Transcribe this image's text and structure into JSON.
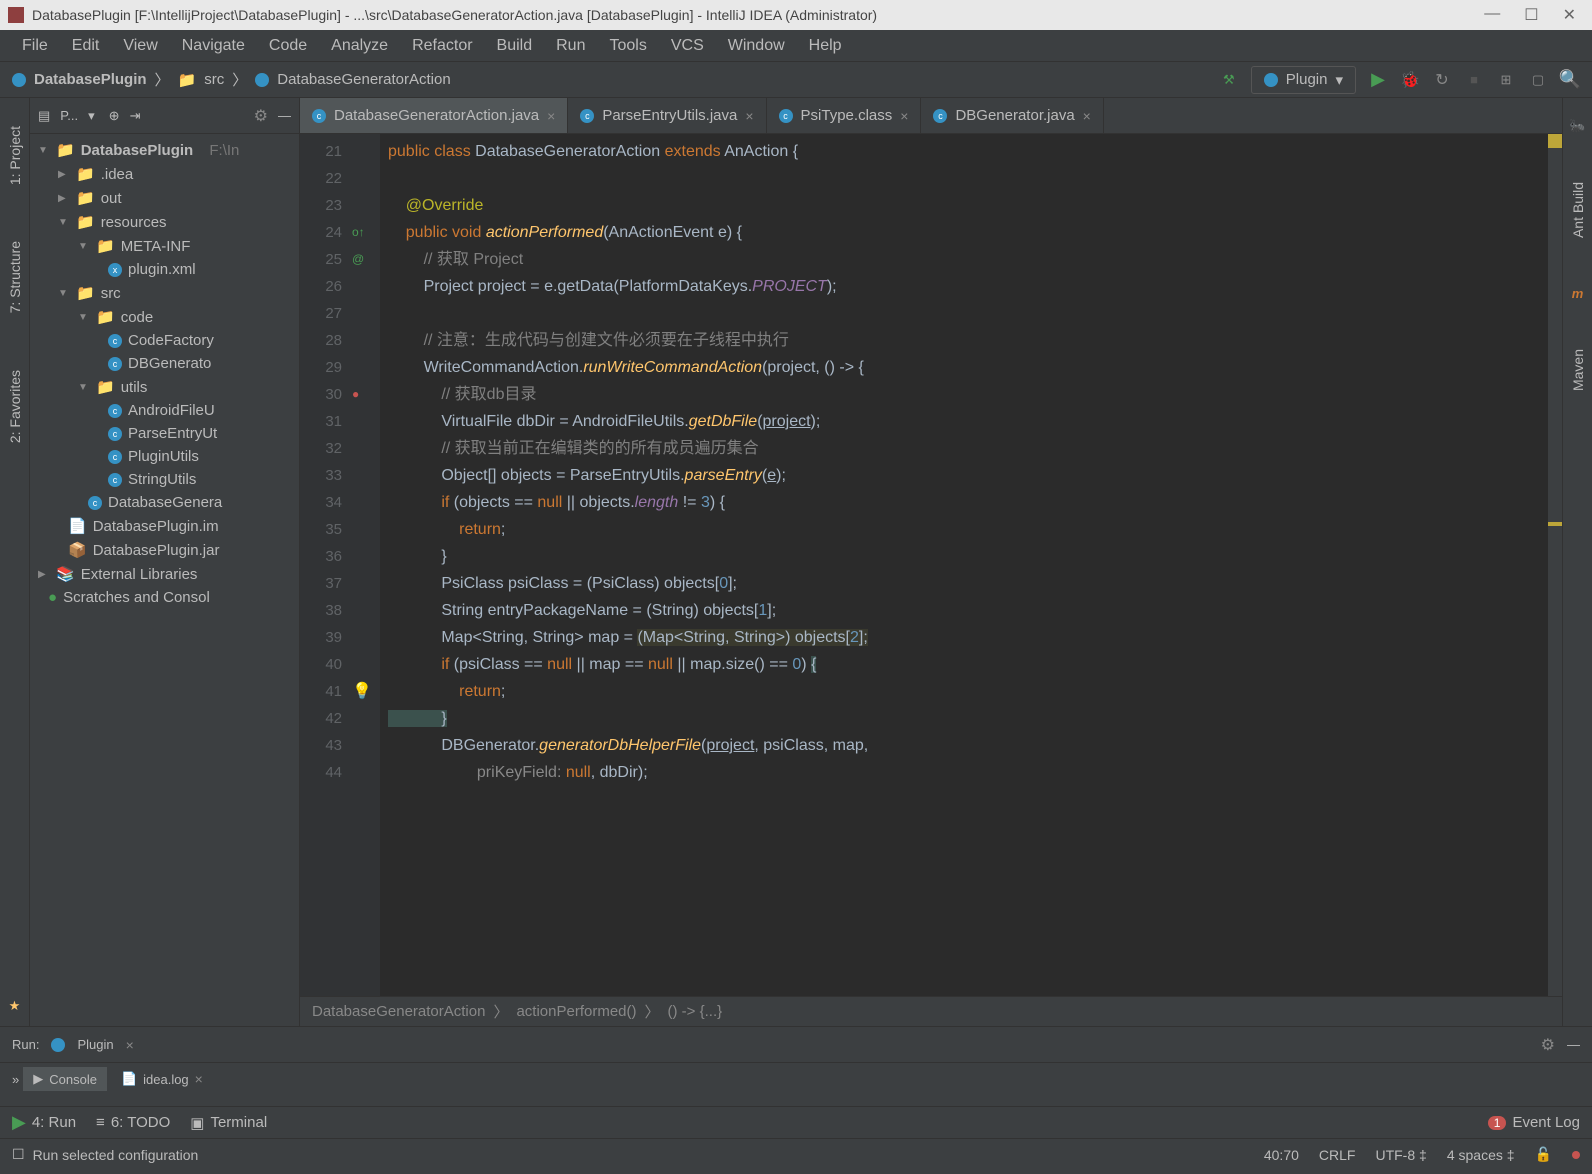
{
  "titlebar": {
    "title": "DatabasePlugin [F:\\IntellijProject\\DatabasePlugin] - ...\\src\\DatabaseGeneratorAction.java [DatabasePlugin] - IntelliJ IDEA (Administrator)"
  },
  "menu": [
    "File",
    "Edit",
    "View",
    "Navigate",
    "Code",
    "Analyze",
    "Refactor",
    "Build",
    "Run",
    "Tools",
    "VCS",
    "Window",
    "Help"
  ],
  "breadcrumb": {
    "root": "DatabasePlugin",
    "folder": "src",
    "file": "DatabaseGeneratorAction"
  },
  "runConfig": {
    "label": "Plugin"
  },
  "sidebarLeft": [
    "1: Project",
    "7: Structure",
    "2: Favorites"
  ],
  "sidebarRight": [
    "Ant Build",
    "Maven"
  ],
  "projectHeader": {
    "label": "P..."
  },
  "tree": {
    "root": "DatabasePlugin",
    "rootPath": "F:\\In",
    "idea": ".idea",
    "out": "out",
    "resources": "resources",
    "metainf": "META-INF",
    "pluginxml": "plugin.xml",
    "src": "src",
    "code": "code",
    "cf": "CodeFactory",
    "dbg": "DBGenerato",
    "utils": "utils",
    "afu": "AndroidFileU",
    "peu": "ParseEntryUt",
    "pu": "PluginUtils",
    "su": "StringUtils",
    "dga": "DatabaseGenera",
    "iml": "DatabasePlugin.im",
    "jar": "DatabasePlugin.jar",
    "ext": "External Libraries",
    "scratch": "Scratches and Consol"
  },
  "tabs": [
    {
      "name": "DatabaseGeneratorAction.java",
      "active": true
    },
    {
      "name": "ParseEntryUtils.java",
      "active": false
    },
    {
      "name": "PsiType.class",
      "active": false
    },
    {
      "name": "DBGenerator.java",
      "active": false
    }
  ],
  "gutter": [
    "21",
    "22",
    "23",
    "24",
    "25",
    "26",
    "27",
    "28",
    "29",
    "30",
    "31",
    "32",
    "33",
    "34",
    "35",
    "36",
    "37",
    "38",
    "39",
    "40",
    "41",
    "42",
    "43",
    "44"
  ],
  "code": {
    "l21a": "public class ",
    "l21b": "DatabaseGeneratorAction ",
    "l21c": "extends ",
    "l21d": "AnAction {",
    "l23": "    @Override",
    "l24a": "    public void ",
    "l24b": "actionPerformed",
    "l24c": "(AnActionEvent e) {",
    "l25": "        // 获取 Project",
    "l26a": "        Project project = e.getData(PlatformDataKeys.",
    "l26b": "PROJECT",
    "l26c": ");",
    "l28": "        // 注意：生成代码与创建文件必须要在子线程中执行",
    "l29a": "        WriteCommandAction.",
    "l29b": "runWriteCommandAction",
    "l29c": "(project, () -> {",
    "l30": "            // 获取db目录",
    "l31a": "            VirtualFile dbDir = AndroidFileUtils.",
    "l31b": "getDbFile",
    "l31c": "(",
    "l31d": "project",
    "l31e": ");",
    "l32": "            // 获取当前正在编辑类的的所有成员遍历集合",
    "l33a": "            Object[] objects = ParseEntryUtils.",
    "l33b": "parseEntry",
    "l33c": "(",
    "l33d": "e",
    "l33e": ");",
    "l34a": "            if ",
    "l34b": "(objects == ",
    "l34c": "null ",
    "l34d": "|| objects.",
    "l34e": "length ",
    "l34f": "!= ",
    "l34g": "3",
    "l34h": ") {",
    "l35a": "                return",
    "l35b": ";",
    "l36": "            }",
    "l37a": "            PsiClass psiClass = (PsiClass) objects[",
    "l37b": "0",
    "l37c": "];",
    "l38a": "            String entryPackageName = (String) objects[",
    "l38b": "1",
    "l38c": "];",
    "l39a": "            Map<String, String> map = ",
    "l39b": "(Map<String, String>) objects[",
    "l39c": "2",
    "l39d": "];",
    "l40a": "            if ",
    "l40b": "(psiClass == ",
    "l40c": "null ",
    "l40d": "|| map == ",
    "l40e": "null ",
    "l40f": "|| map.size() == ",
    "l40g": "0",
    "l40h": ") ",
    "l40i": "{",
    "l41a": "                return",
    "l41b": ";",
    "l42": "            }",
    "l43a": "            DBGenerator.",
    "l43b": "generatorDbHelperFile",
    "l43c": "(",
    "l43d": "project",
    "l43e": ", psiClass, map,",
    "l44a": "                    priKeyField: ",
    "l44b": "null",
    "l44c": ", dbDir);"
  },
  "editorBreadcrumb": [
    "DatabaseGeneratorAction",
    "actionPerformed()",
    "() -> {...}"
  ],
  "runPanel": {
    "title": "Run:",
    "config": "Plugin",
    "tabs": [
      "Console",
      "idea.log"
    ]
  },
  "bottomBar": {
    "run": "4: Run",
    "todo": "6: TODO",
    "terminal": "Terminal",
    "eventLog": "Event Log",
    "eventCount": "1"
  },
  "statusBar": {
    "msg": "Run selected configuration",
    "pos": "40:70",
    "eol": "CRLF",
    "enc": "UTF-8",
    "indent": "4 spaces"
  }
}
